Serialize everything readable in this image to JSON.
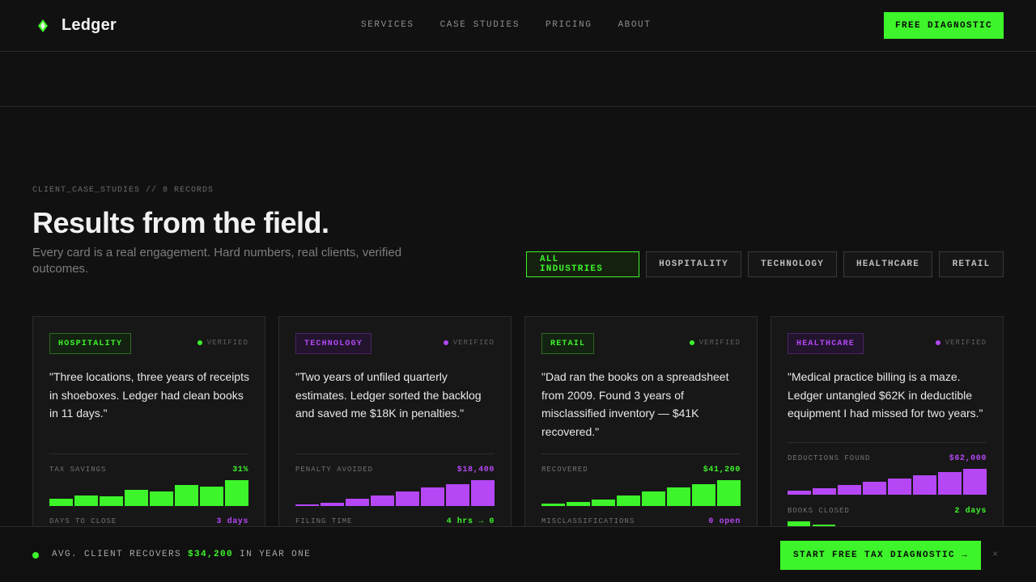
{
  "brand": {
    "name": "Ledger",
    "accent": "#3df52a",
    "accent_alt": "#b547f5"
  },
  "nav": {
    "items": [
      "SERVICES",
      "CASE STUDIES",
      "PRICING",
      "ABOUT"
    ]
  },
  "header": {
    "cta": "FREE DIAGNOSTIC"
  },
  "section": {
    "eyebrow": "CLIENT_CASE_STUDIES // 8 RECORDS",
    "title": "Results from the field.",
    "subtitle": "Every card is a real engagement. Hard numbers, real clients, verified outcomes."
  },
  "filters": [
    "ALL INDUSTRIES",
    "HOSPITALITY",
    "TECHNOLOGY",
    "HEALTHCARE",
    "RETAIL"
  ],
  "cards": [
    {
      "tag": "HOSPITALITY",
      "verified": "VERIFIED",
      "quote": "\"Three locations, three years of receipts in shoeboxes. Ledger had clean books in 11 days.\"",
      "metric_label": "TAX SAVINGS",
      "metric_value": "31%",
      "bars": [
        0.28,
        0.42,
        0.38,
        0.62,
        0.55,
        0.82,
        0.75,
        1.0
      ],
      "metric2_label": "DAYS TO CLOSE",
      "metric2_value": "3 days"
    },
    {
      "tag": "TECHNOLOGY",
      "verified": "VERIFIED",
      "quote": "\"Two years of unfiled quarterly estimates. Ledger sorted the backlog and saved me $18K in penalties.\"",
      "metric_label": "PENALTY AVOIDED",
      "metric_value": "$18,400",
      "bars": [
        0.06,
        0.12,
        0.28,
        0.42,
        0.57,
        0.72,
        0.85,
        1.0
      ],
      "metric2_label": "FILING TIME",
      "metric2_value": "4 hrs → 0"
    },
    {
      "tag": "RETAIL",
      "verified": "VERIFIED",
      "quote": "\"Dad ran the books on a spreadsheet from 2009. Found 3 years of misclassified inventory — $41K recovered.\"",
      "metric_label": "RECOVERED",
      "metric_value": "$41,200",
      "bars": [
        0.1,
        0.16,
        0.26,
        0.42,
        0.55,
        0.72,
        0.85,
        1.0
      ],
      "metric2_label": "MISCLASSIFICATIONS",
      "metric2_value": "0 open"
    },
    {
      "tag": "HEALTHCARE",
      "verified": "VERIFIED",
      "quote": "\"Medical practice billing is a maze. Ledger untangled $62K in deductible equipment I had missed for two years.\"",
      "metric_label": "DEDUCTIONS FOUND",
      "metric_value": "$62,000",
      "bars": [
        0.15,
        0.26,
        0.37,
        0.5,
        0.62,
        0.75,
        0.87,
        1.0
      ],
      "metric2_label": "BOOKS CLOSED",
      "metric2_value": "2 days"
    }
  ],
  "bottom_bar": {
    "prefix": "AVG. CLIENT RECOVERS",
    "amount": "$34,200",
    "suffix": "IN YEAR ONE",
    "cta": "START FREE TAX DIAGNOSTIC →",
    "close": "×"
  }
}
